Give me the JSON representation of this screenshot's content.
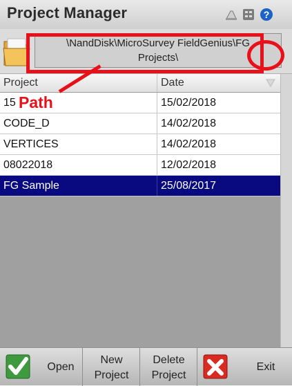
{
  "window": {
    "title": "Project Manager"
  },
  "path": {
    "line1": "\\NandDisk\\MicroSurvey FieldGenius\\FG",
    "line2": "Projects\\"
  },
  "annotation": {
    "label": "Path"
  },
  "table": {
    "columns": [
      "Project",
      "Date"
    ],
    "rows": [
      {
        "project": "15",
        "date": "15/02/2018"
      },
      {
        "project": "CODE_D",
        "date": "14/02/2018"
      },
      {
        "project": "VERTICES",
        "date": "14/02/2018"
      },
      {
        "project": "08022018",
        "date": "12/02/2018"
      },
      {
        "project": "FG Sample",
        "date": "25/08/2017",
        "selected": true
      }
    ]
  },
  "toolbar": {
    "open_label": "Open",
    "new_label_1": "New",
    "new_label_2": "Project",
    "delete_label_1": "Delete",
    "delete_label_2": "Project",
    "exit_label": "Exit"
  },
  "icons": {
    "title_bar": [
      "keyboard-icon",
      "calculator-icon",
      "help-icon"
    ],
    "folder": "folder-icon",
    "open": "checkmark-icon",
    "exit": "close-icon"
  },
  "colors": {
    "selection": "#0a0a80",
    "annotation": "#e8111a",
    "help": "#1b63c6"
  }
}
